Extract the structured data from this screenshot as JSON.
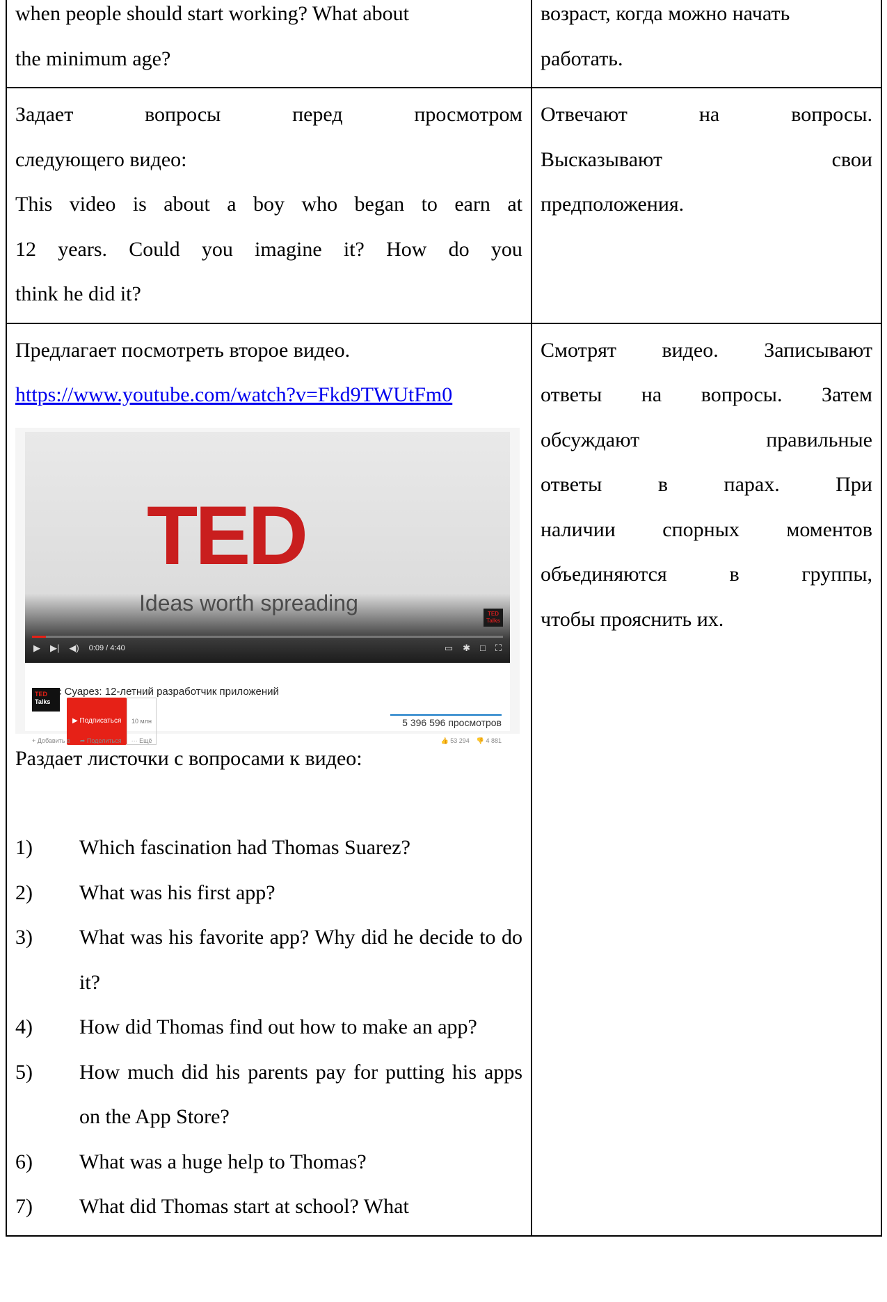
{
  "rows": [
    {
      "left_lines": [
        "when people should start working? What about",
        "the minimum age?"
      ],
      "right_lines": [
        "возраст, когда можно начать",
        "работать."
      ]
    },
    {
      "left_lines": [
        "Задает вопросы перед просмотром",
        "следующего видео:",
        "This video is about a boy who began to earn at",
        "12 years. Could you imagine it? How do you",
        "think he did it?"
      ],
      "right_lines": [
        "Отвечают на вопросы.",
        "Высказывают свои",
        "предположения."
      ]
    }
  ],
  "row3": {
    "intro": "Предлагает посмотреть второе видео.",
    "link": "https://www.youtube.com/watch?v=Fkd9TWUtFm0",
    "handout_intro": "Раздает листочки с вопросами к видео:",
    "questions": [
      {
        "num": "1)",
        "text": "Which fascination had Thomas Suarez?"
      },
      {
        "num": "2)",
        "text": "What was his first app?"
      },
      {
        "num": "3)",
        "text": "What was his favorite app? Why did he decide to do it?"
      },
      {
        "num": "4)",
        "text": "How did Thomas find out how to make an app?"
      },
      {
        "num": "5)",
        "text": "How much did his parents pay for putting his apps on the App Store?"
      },
      {
        "num": "6)",
        "text": "What was a huge help to Thomas?"
      },
      {
        "num": "7)",
        "text": "What did Thomas start at school? What"
      }
    ],
    "right_lines": [
      "Смотрят видео. Записывают",
      "ответы на вопросы. Затем",
      "обсуждают правильные",
      "ответы в парах. При",
      "наличии спорных моментов",
      "объединяются в группы,",
      "чтобы прояснить их."
    ]
  },
  "video": {
    "logo": "TED",
    "tagline": "Ideas worth spreading",
    "badge": "TED Talks",
    "time": "0:09 / 4:40",
    "progress": 0.03,
    "title": "Томас Суарез: 12-летний разработчик приложений",
    "channel": "TED",
    "channel_logo_top": "TED",
    "channel_logo_bottom": "Talks",
    "subscribe": "Подписаться",
    "subscribers": "10 млн",
    "views": "5 396 596 просмотров",
    "add_to": "Добавить в",
    "share": "Поделиться",
    "more": "Ещё",
    "likes": "53 294",
    "dislikes": "4 881",
    "accent": "#c91e1e"
  }
}
